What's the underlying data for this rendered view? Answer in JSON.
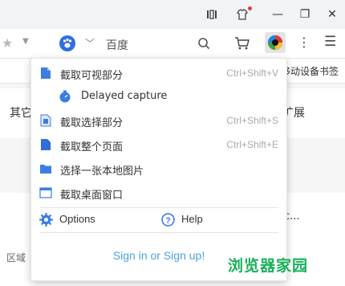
{
  "window_controls": {
    "reader_icon": "reader-mode-icon",
    "skin_icon": "skin-icon",
    "minimize": "—",
    "restore": "❐",
    "close": "✕"
  },
  "toolbar": {
    "search_engine_label": "百度",
    "search_icon": "search-icon",
    "cart_icon": "cart-icon",
    "more": "⋮",
    "menu": "☰"
  },
  "bookmarks": {
    "mobile_bookmarks": "移动设备书签"
  },
  "page": {
    "left_tab": "其它",
    "right_tab": "扩展",
    "card_right_text": "c...",
    "region_label": "区域"
  },
  "popup": {
    "items": [
      {
        "label": "截取可视部分",
        "shortcut": "Ctrl+Shift+V"
      },
      {
        "label": "Delayed capture",
        "shortcut": ""
      },
      {
        "label": "截取选择部分",
        "shortcut": "Ctrl+Shift+S"
      },
      {
        "label": "截取整个页面",
        "shortcut": "Ctrl+Shift+E"
      },
      {
        "label": "选择一张本地图片",
        "shortcut": ""
      },
      {
        "label": "截取桌面窗口",
        "shortcut": ""
      }
    ],
    "options_label": "Options",
    "help_label": "Help",
    "signin_label": "Sign in or Sign up!"
  },
  "watermark": "浏览器家园",
  "colors": {
    "accent_blue": "#3b7de0",
    "link_blue": "#4aa3df",
    "watermark_green": "#19b05a"
  }
}
